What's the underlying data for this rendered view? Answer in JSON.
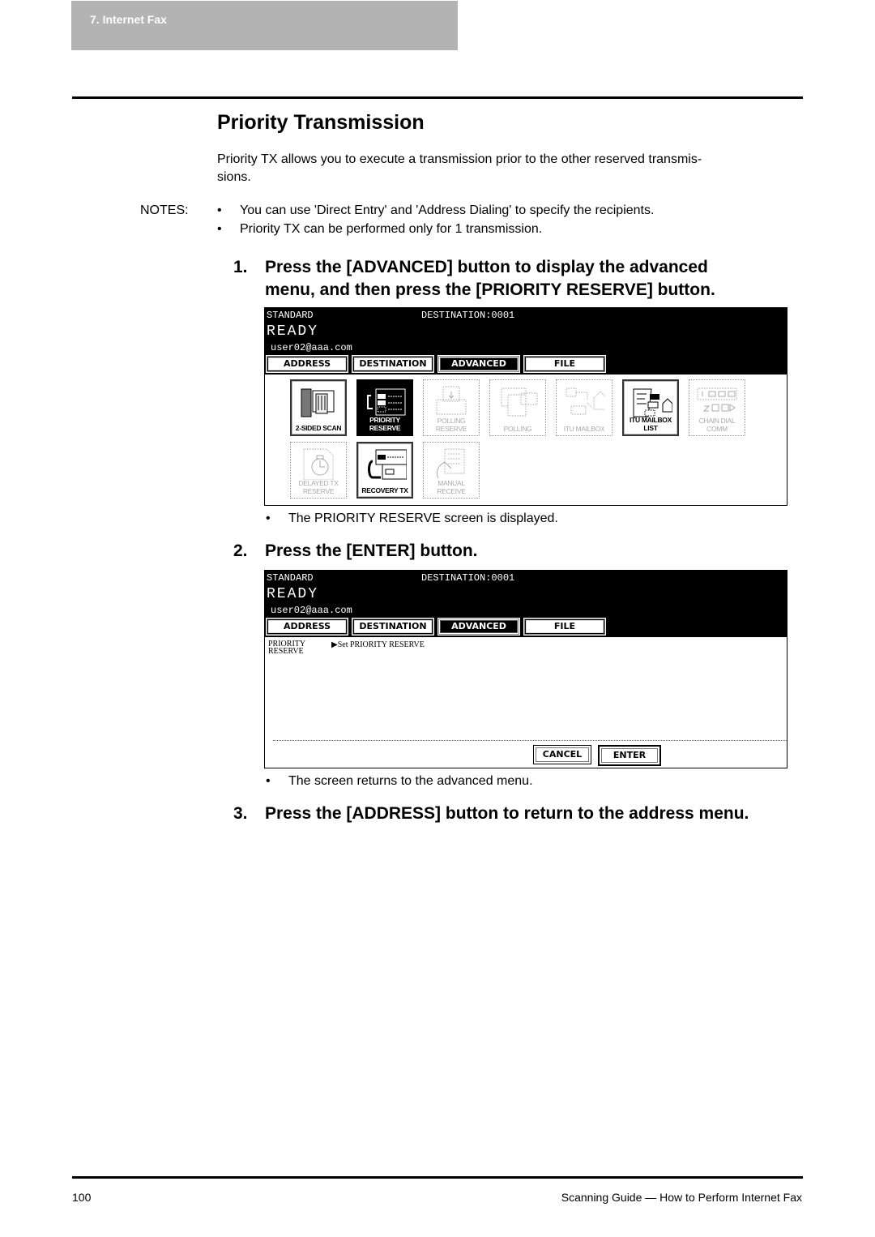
{
  "header": {
    "chapter": "7. Internet Fax"
  },
  "section": {
    "title": "Priority Transmission",
    "intro_line1": "Priority TX allows you to execute a transmission prior to the other reserved transmis-",
    "intro_line2": "sions.",
    "notes_label": "NOTES:",
    "notes": [
      "You can use 'Direct Entry' and 'Address Dialing' to specify the recipients.",
      "Priority TX can be performed only for 1 transmission."
    ],
    "bullet_glyph": "•"
  },
  "steps": [
    {
      "num": "1.",
      "line1": "Press the [ADVANCED] button to display the advanced",
      "line2": "menu, and then press the [PRIORITY RESERVE] button.",
      "result": "The PRIORITY RESERVE screen is displayed."
    },
    {
      "num": "2.",
      "line1": "Press the [ENTER] button.",
      "result": "The screen returns to the advanced menu."
    },
    {
      "num": "3.",
      "line1": "Press the [ADDRESS] button to return to the address menu."
    }
  ],
  "device_screen": {
    "mode": "STANDARD",
    "destination": "DESTINATION:0001",
    "status": "READY",
    "user": "user02@aaa.com",
    "tabs": [
      "ADDRESS",
      "DESTINATION",
      "ADVANCED",
      "FILE"
    ],
    "active_tab": "ADVANCED"
  },
  "advanced_menu": {
    "icons": [
      {
        "label": "2-SIDED SCAN",
        "state": "enabled",
        "icon": "two-sided-scan-icon"
      },
      {
        "label": "PRIORITY RESERVE",
        "state": "selected",
        "icon": "priority-reserve-icon"
      },
      {
        "label": "POLLING RESERVE",
        "state": "disabled",
        "icon": "polling-reserve-icon"
      },
      {
        "label": "POLLING",
        "state": "disabled",
        "icon": "polling-icon"
      },
      {
        "label": "ITU MAILBOX",
        "state": "disabled",
        "icon": "itu-mailbox-icon"
      },
      {
        "label": "ITU MAILBOX LIST",
        "state": "enabled",
        "icon": "itu-mailbox-list-icon"
      },
      {
        "label": "CHAIN DIAL COMM",
        "state": "disabled",
        "icon": "chain-dial-icon"
      },
      {
        "label": "DELAYED TX RESERVE",
        "state": "disabled",
        "icon": "delayed-tx-icon"
      },
      {
        "label": "RECOVERY TX",
        "state": "enabled",
        "icon": "recovery-tx-icon"
      },
      {
        "label": "MANUAL RECEIVE",
        "state": "disabled",
        "icon": "manual-receive-icon"
      }
    ]
  },
  "priority_screen": {
    "label_line1": "PRIORITY",
    "label_line2": "RESERVE",
    "setting": "▶Set PRIORITY RESERVE",
    "cancel": "CANCEL",
    "enter": "ENTER"
  },
  "footer": {
    "page_number": "100",
    "doc_title": "Scanning Guide — How to Perform Internet Fax"
  }
}
